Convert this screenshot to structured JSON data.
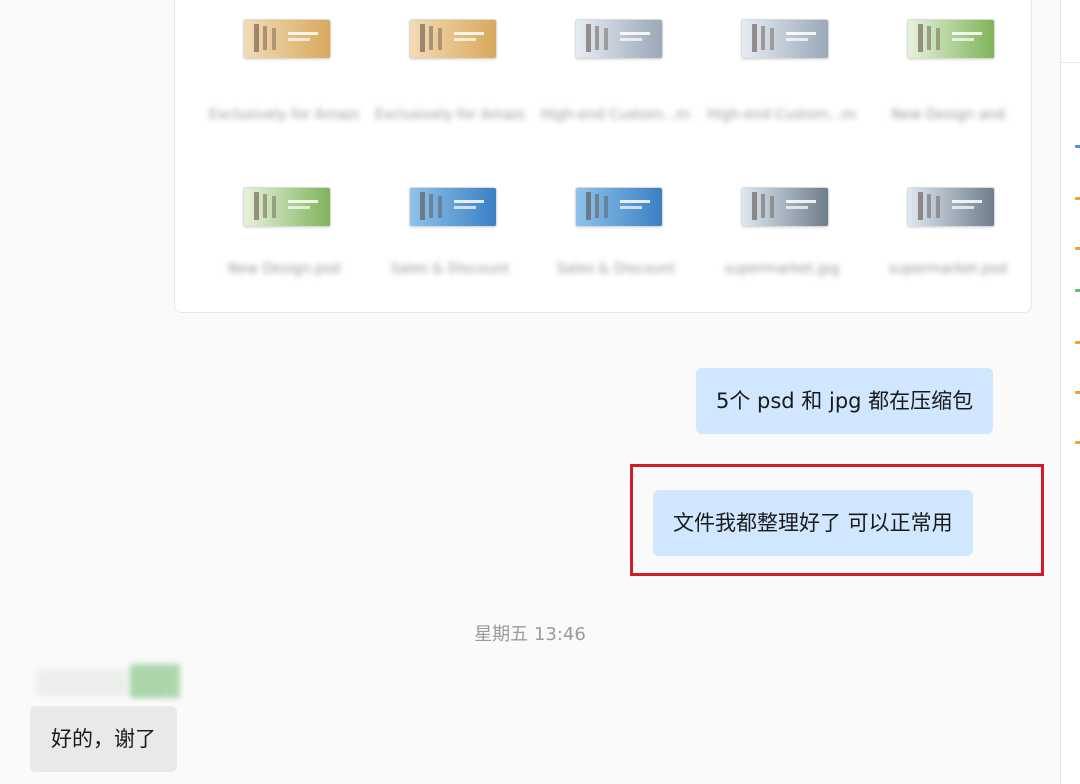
{
  "files": [
    {
      "name": "Exclusively for Amazon.psd",
      "thumb_bg": "#f1dcb5",
      "thumb_accent": "#d9a85d"
    },
    {
      "name": "Exclusively for Amazon.jpg",
      "thumb_bg": "#f1dcb5",
      "thumb_accent": "#d9a85d"
    },
    {
      "name": "High-end Custom...mes.psd",
      "thumb_bg": "#e7ecf3",
      "thumb_accent": "#9aa8b8"
    },
    {
      "name": "High-end Custom...mes.jpg",
      "thumb_bg": "#e7ecf3",
      "thumb_accent": "#9aa8b8"
    },
    {
      "name": "New Design and",
      "thumb_bg": "#e6f2dc",
      "thumb_accent": "#7fb45a"
    },
    {
      "name": "New Design.psd",
      "thumb_bg": "#e6f2dc",
      "thumb_accent": "#7fb45a"
    },
    {
      "name": "Sales & Discount",
      "thumb_bg": "#8fc3ea",
      "thumb_accent": "#3b7fc4"
    },
    {
      "name": "Sales & Discount",
      "thumb_bg": "#8fc3ea",
      "thumb_accent": "#3b7fc4"
    },
    {
      "name": "supermarket.jpg",
      "thumb_bg": "#dde8f2",
      "thumb_accent": "#6f7d8c"
    },
    {
      "name": "supermarket.psd",
      "thumb_bg": "#dde8f2",
      "thumb_accent": "#6f7d8c"
    }
  ],
  "messages": {
    "out_1": "5个 psd 和 jpg 都在压缩包",
    "out_2": "文件我都整理好了 可以正常用",
    "time_separator": "星期五 13:46",
    "in_1": "好的，谢了"
  },
  "colors": {
    "outgoing_bubble": "#d1e6ff",
    "incoming_bubble": "#e9e9e9",
    "highlight": "#cf1e25"
  }
}
